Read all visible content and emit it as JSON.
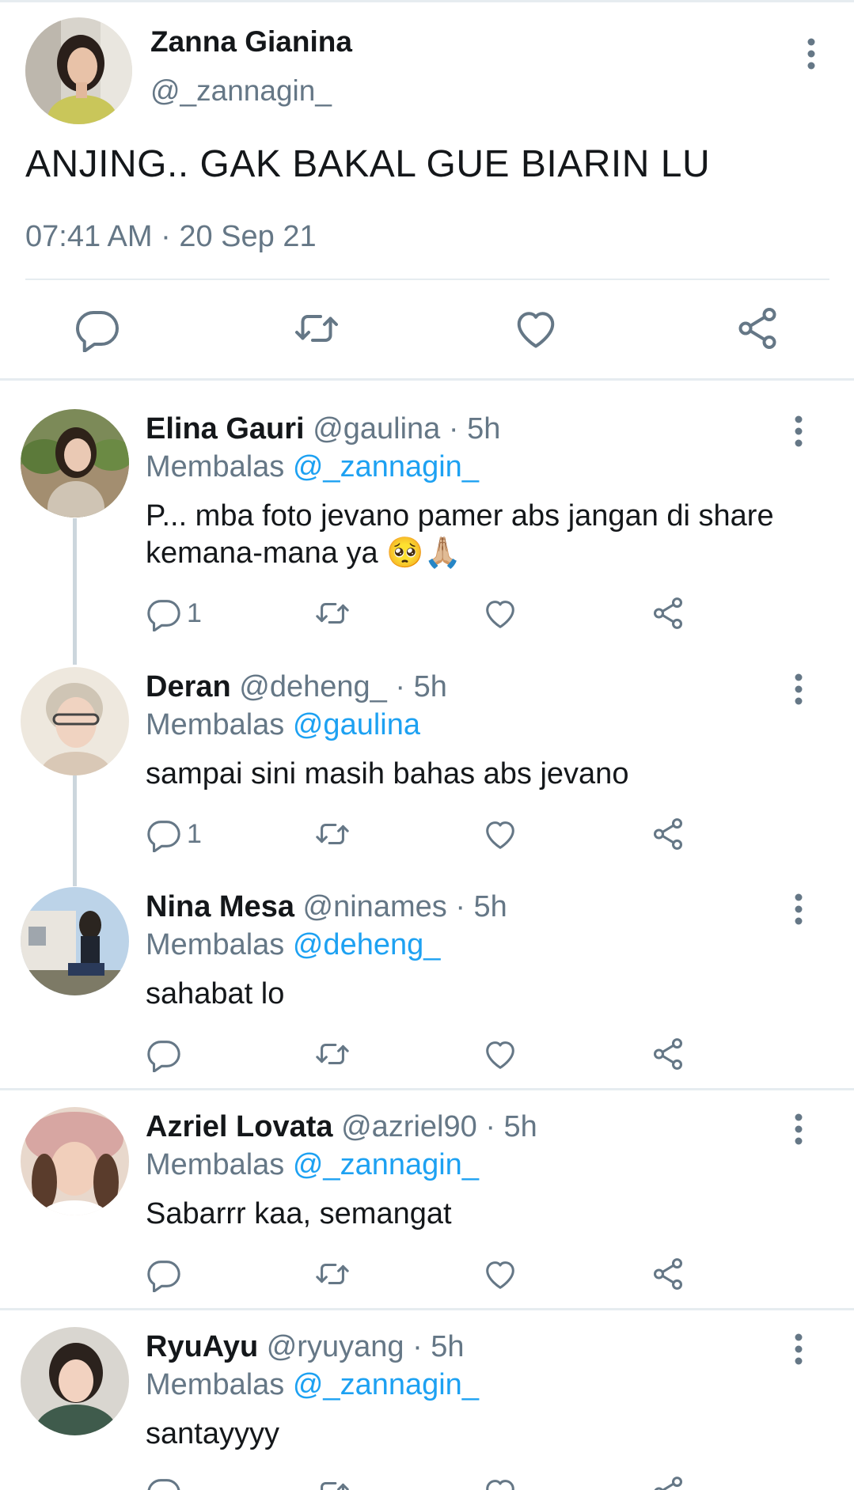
{
  "main_tweet": {
    "name": "Zanna Gianina",
    "handle": "@_zannagin_",
    "text": "ANJING.. GAK BAKAL GUE BIARIN LU",
    "timestamp": "07:41 AM · 20 Sep 21",
    "actions": [
      "reply-icon",
      "retweet-icon",
      "like-icon",
      "share-icon"
    ]
  },
  "replies": [
    {
      "name": "Elina Gauri",
      "handle": "@gaulina",
      "time": "· 5h",
      "replying_prefix": "Membalas",
      "replying_to": "@_zannagin_",
      "text": "P... mba foto jevano pamer abs jangan di share kemana-mana ya 🥺🙏🏼",
      "reply_count": "1"
    },
    {
      "name": "Deran",
      "handle": "@deheng_",
      "time": "· 5h",
      "replying_prefix": "Membalas",
      "replying_to": "@gaulina",
      "text": "sampai sini masih bahas abs jevano",
      "reply_count": "1"
    },
    {
      "name": "Nina Mesa",
      "handle": "@ninames",
      "time": "· 5h",
      "replying_prefix": "Membalas",
      "replying_to": "@deheng_",
      "text": "sahabat lo",
      "reply_count": ""
    },
    {
      "name": "Azriel Lovata",
      "handle": "@azriel90",
      "time": "· 5h",
      "replying_prefix": "Membalas",
      "replying_to": "@_zannagin_",
      "text": "Sabarrr kaa, semangat",
      "reply_count": ""
    },
    {
      "name": "RyuAyu",
      "handle": "@ryuyang",
      "time": "· 5h",
      "replying_prefix": "Membalas",
      "replying_to": "@_zannagin_",
      "text": "santayyyy",
      "reply_count": ""
    }
  ],
  "colors": {
    "text": "#14171a",
    "secondary": "#657786",
    "link": "#1da1f2",
    "divider": "#e6ecf0",
    "icon": "#657786"
  }
}
